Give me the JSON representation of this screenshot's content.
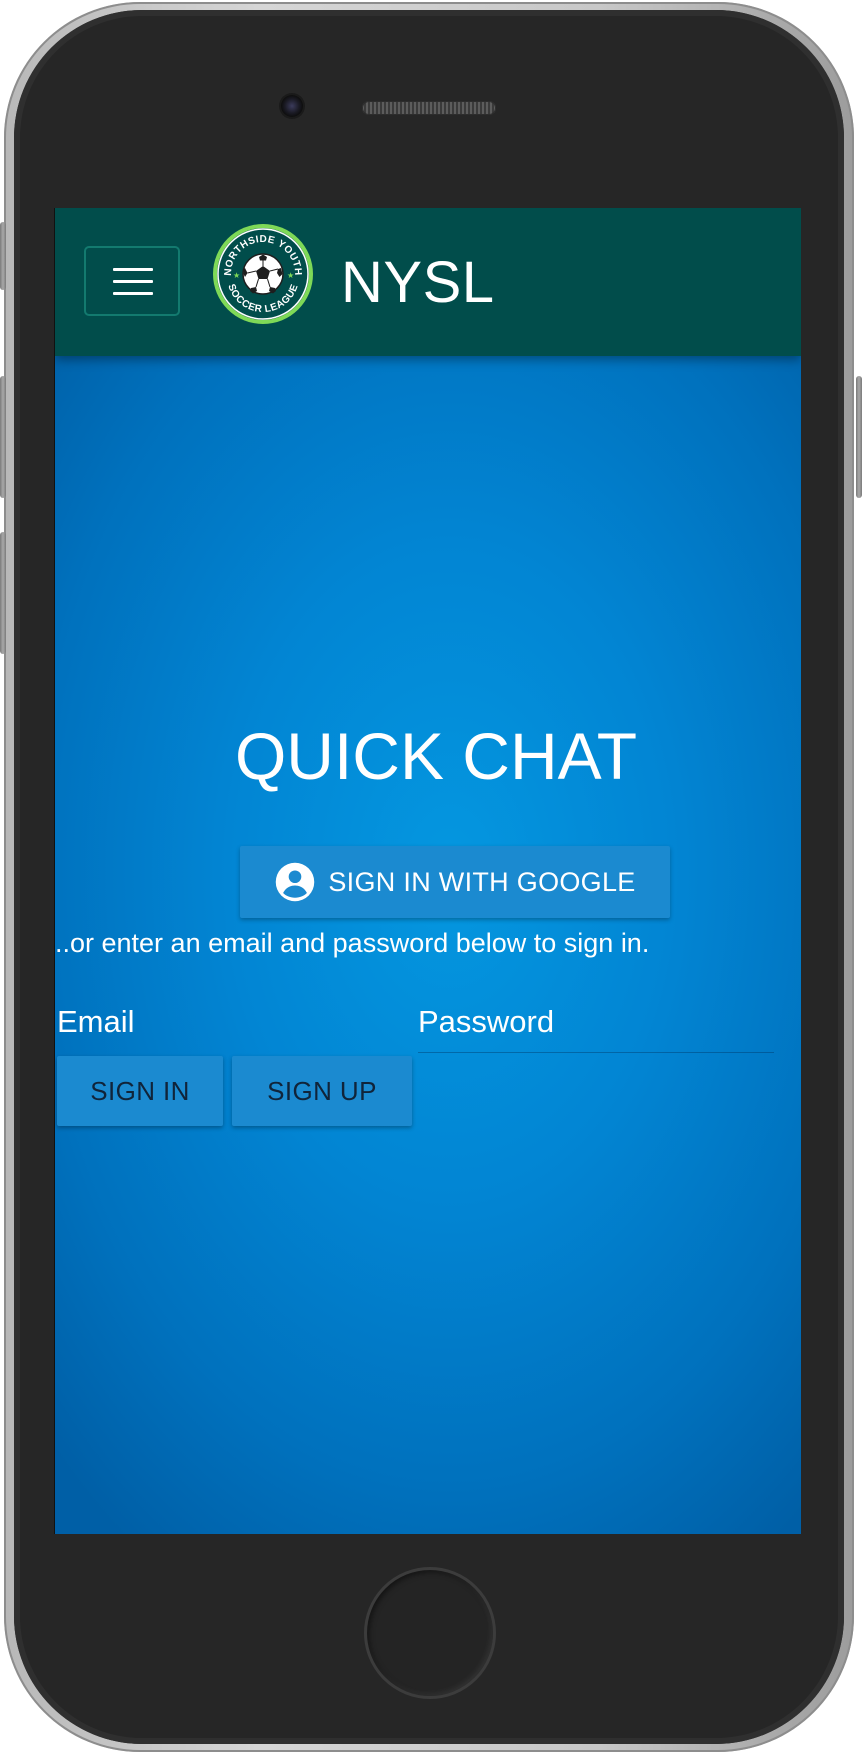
{
  "navbar": {
    "brand": "NYSL",
    "logo_top_text": "NORTHSIDE YOUTH",
    "logo_bottom_text": "SOCCER LEAGUE"
  },
  "main": {
    "title": "QUICK CHAT",
    "google_button_label": "SIGN IN WITH GOOGLE",
    "hint": "..or enter an email and password below to sign in.",
    "email_label": "Email",
    "password_label": "Password",
    "sign_in_label": "SIGN IN",
    "sign_up_label": "SIGN UP"
  },
  "colors": {
    "navbar": "#014d4b",
    "background": "#0285d3",
    "button": "#1b8ad0",
    "logo_accent": "#7ed957"
  },
  "icons": {
    "menu": "hamburger-menu-icon",
    "google_button": "account-circle-icon"
  }
}
